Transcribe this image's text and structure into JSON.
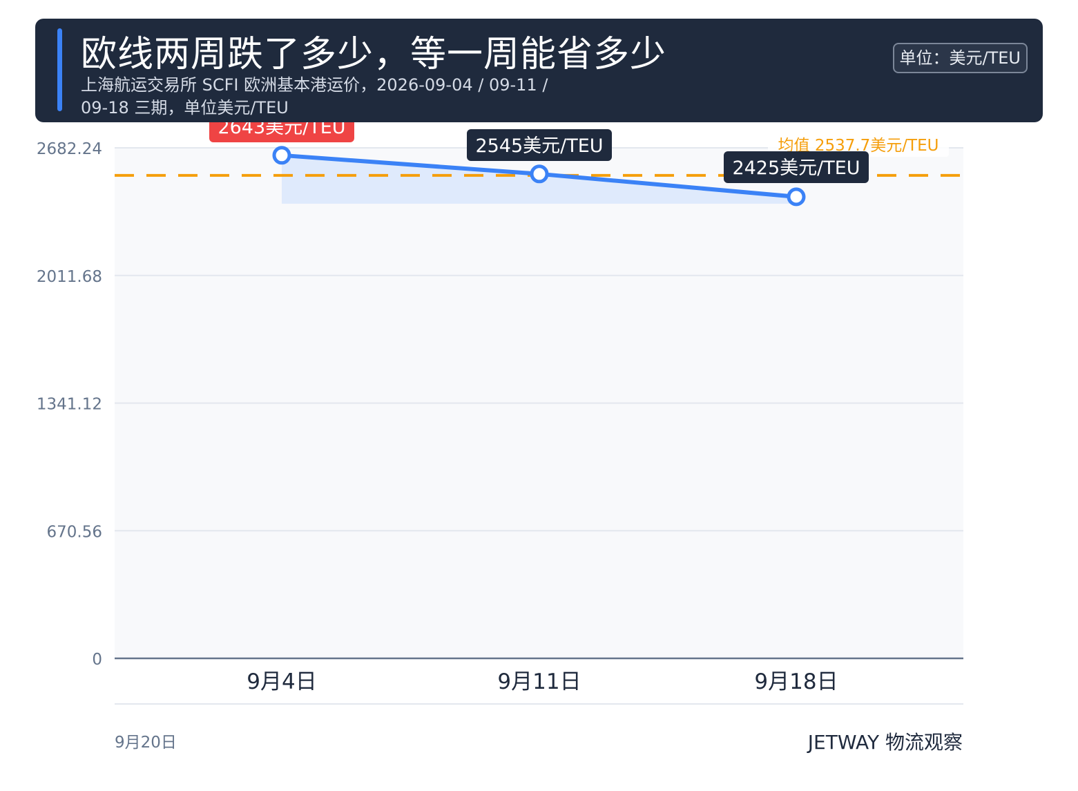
{
  "header": {
    "title": "欧线两周跌了多少，等一周能省多少",
    "subtitle": "上海航运交易所 SCFI 欧洲基本港运价，2026-09-04 / 09-11 / 09-18 三期，单位美元/TEU",
    "unit_badge": "单位：美元/TEU"
  },
  "colors": {
    "header_bg": "#1f2a3d",
    "accent": "#3b82f6",
    "line": "#3b82f6",
    "area_fill": "#dbe7fb",
    "mean_line": "#f59e0b",
    "highlight_label": "#ef4444",
    "dark_label": "#1f2a3d",
    "plot_bg": "#f8f9fb",
    "grid": "#e3e7ee"
  },
  "chart_data": {
    "type": "line",
    "categories": [
      "9月4日",
      "9月11日",
      "9月18日"
    ],
    "series": [
      {
        "values": [
          2643,
          2545,
          2425
        ]
      }
    ],
    "point_labels": [
      "2643美元/TEU",
      "2545美元/TEU",
      "2425美元/TEU"
    ],
    "highlight_index": 0,
    "mean": {
      "value": 2537.7,
      "label": "均值 2537.7美元/TEU"
    },
    "y_ticks": [
      "0",
      "670.56",
      "1341.12",
      "2011.68",
      "2682.24"
    ],
    "ylim": [
      0,
      2682.24
    ],
    "xlabel": "",
    "ylabel": "",
    "grid": true,
    "area_baseline": 2425
  },
  "footer": {
    "date": "9月20日",
    "brand": "JETWAY 物流观察"
  }
}
